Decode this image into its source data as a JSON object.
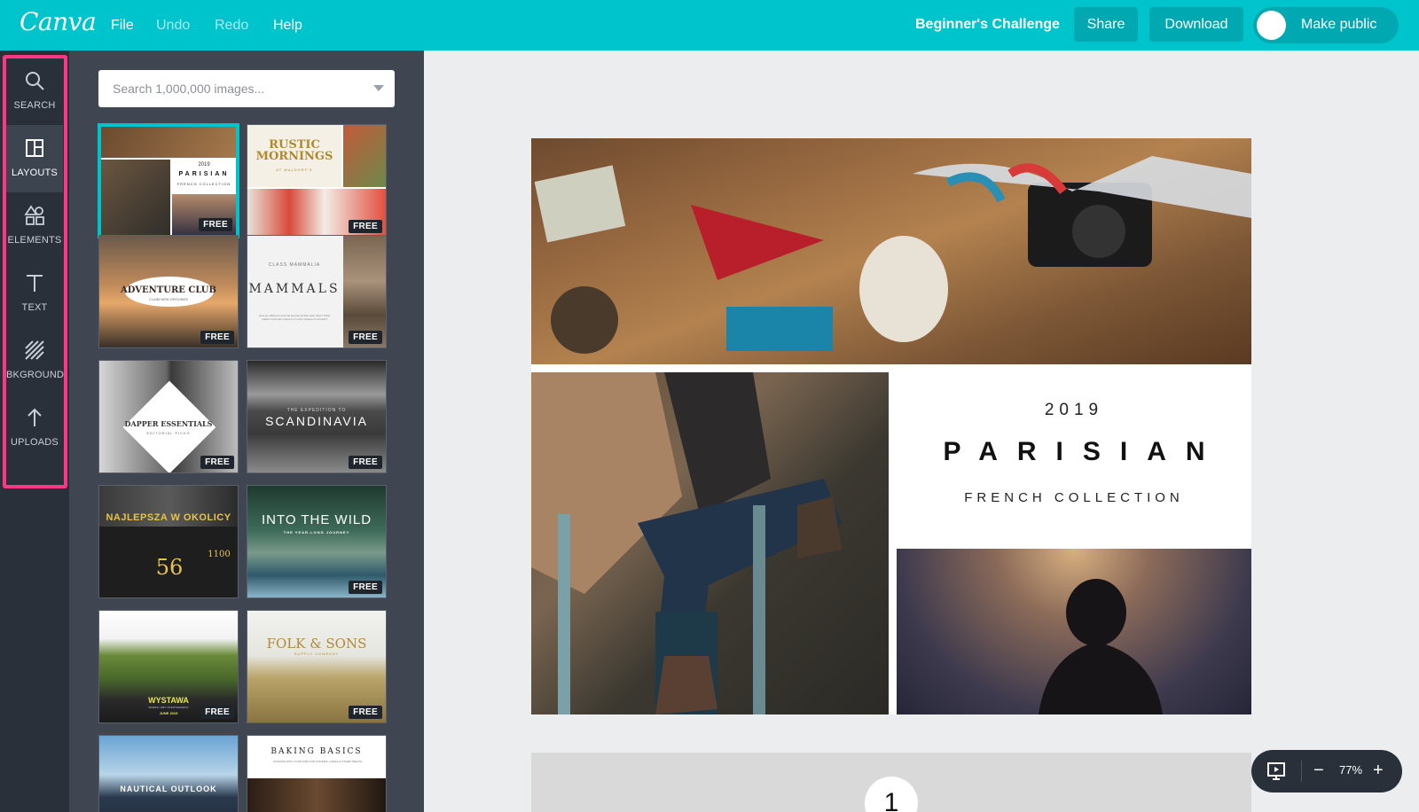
{
  "topbar": {
    "logo": "Canva",
    "menu": {
      "file": "File",
      "undo": "Undo",
      "redo": "Redo",
      "help": "Help"
    },
    "design_title": "Beginner's Challenge",
    "share": "Share",
    "download": "Download",
    "make_public": "Make public"
  },
  "sidebar": {
    "items": [
      {
        "label": "SEARCH",
        "icon": "search-icon"
      },
      {
        "label": "LAYOUTS",
        "icon": "layouts-icon"
      },
      {
        "label": "ELEMENTS",
        "icon": "elements-icon"
      },
      {
        "label": "TEXT",
        "icon": "text-icon"
      },
      {
        "label": "BKGROUND",
        "icon": "background-icon"
      },
      {
        "label": "UPLOADS",
        "icon": "upload-icon"
      }
    ]
  },
  "panel": {
    "search_placeholder": "Search 1,000,000 images...",
    "free_badge": "FREE",
    "layouts": [
      {
        "title": "PARISIAN",
        "year": "2019",
        "sub": "FRENCH COLLECTION"
      },
      {
        "title": "RUSTIC MORNINGS",
        "sub": "AT WALDORF'S"
      },
      {
        "title": "ADVENTURE CLUB",
        "sub": "CLAIM NEW GROUNDS"
      },
      {
        "title": "MAMMALS",
        "top": "CLASS MAMMALIA",
        "sub": "How are different mammal species similar each other? What makes mammals unique from other classes of animals?"
      },
      {
        "title": "DAPPER ESSENTIALS",
        "sub": "EDITORIAL PICKS"
      },
      {
        "title": "SCANDINAVIA",
        "top": "THE EXPEDITION TO"
      },
      {
        "title": "NAJLEPSZA W OKOLICY",
        "number": "56",
        "number2": "1100"
      },
      {
        "title": "INTO THE WILD",
        "sub": "THE YEAR-LONG JOURNEY"
      },
      {
        "title": "WYSTAWA",
        "sub": "WORKS / ART / PHOTOGRAPHY",
        "date": "JUNE 2019"
      },
      {
        "title": "FOLK & SONS",
        "sub": "SUPPLY COMPANY"
      },
      {
        "title": "NAUTICAL OUTLOOK"
      },
      {
        "title": "BAKING BASICS",
        "sub": "COOKING WITH YOUR KIDS FOR COOKIES, CAKES & OTHER TREATS"
      }
    ]
  },
  "canvas": {
    "year": "2019",
    "title": "PARISIAN",
    "subtitle": "FRENCH COLLECTION",
    "page2_number": "1"
  },
  "zoom": {
    "value": "77%",
    "minus": "−",
    "plus": "+"
  }
}
